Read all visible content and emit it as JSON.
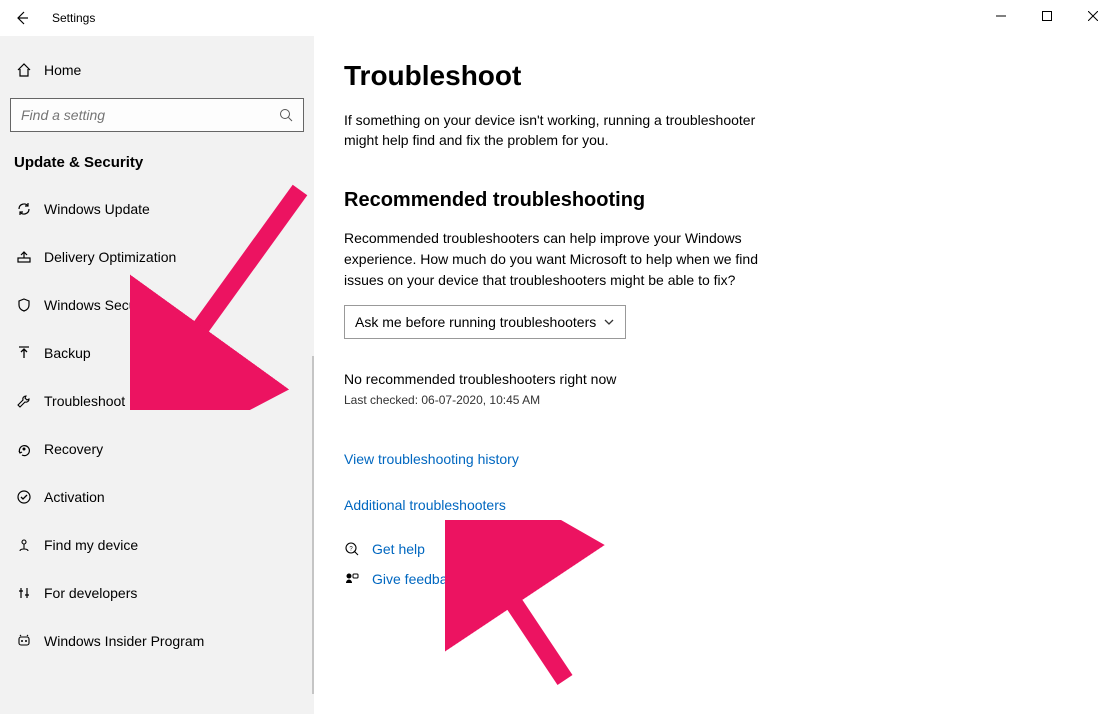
{
  "titlebar": {
    "title": "Settings"
  },
  "sidebar": {
    "home": "Home",
    "search_placeholder": "Find a setting",
    "section": "Update & Security",
    "items": [
      {
        "label": "Windows Update"
      },
      {
        "label": "Delivery Optimization"
      },
      {
        "label": "Windows Security"
      },
      {
        "label": "Backup"
      },
      {
        "label": "Troubleshoot"
      },
      {
        "label": "Recovery"
      },
      {
        "label": "Activation"
      },
      {
        "label": "Find my device"
      },
      {
        "label": "For developers"
      },
      {
        "label": "Windows Insider Program"
      }
    ]
  },
  "main": {
    "title": "Troubleshoot",
    "intro": "If something on your device isn't working, running a troubleshooter might help find and fix the problem for you.",
    "recommended": {
      "heading": "Recommended troubleshooting",
      "para": "Recommended troubleshooters can help improve your Windows experience. How much do you want Microsoft to help when we find issues on your device that troubleshooters might be able to fix?",
      "dropdown": "Ask me before running troubleshooters",
      "status": "No recommended troubleshooters right now",
      "last_checked": "Last checked: 06-07-2020, 10:45 AM"
    },
    "history_link": "View troubleshooting history",
    "additional_link": "Additional troubleshooters",
    "get_help": "Get help",
    "give_feedback": "Give feedback"
  }
}
